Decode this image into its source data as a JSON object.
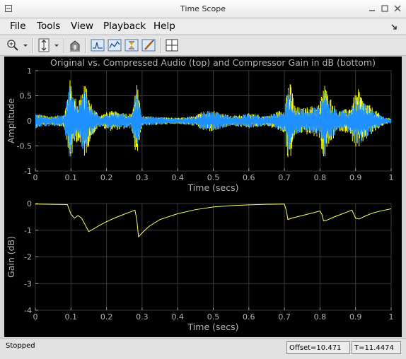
{
  "window": {
    "title": "Time Scope"
  },
  "menu": {
    "items": [
      "File",
      "Tools",
      "View",
      "Playback",
      "Help"
    ]
  },
  "toolbar": {
    "icons": [
      "zoom-in-icon",
      "dropdown-arrow-icon",
      "scale-axes-icon",
      "dropdown-arrow-icon",
      "restore-view-icon",
      "triggers-icon",
      "cursor-measurements-icon",
      "signal-statistics-icon",
      "peak-finder-icon",
      "style-icon",
      "layout-icon"
    ]
  },
  "figure": {
    "title": "Original vs. Compressed Audio (top) and Compressor Gain in dB (bottom)"
  },
  "chart_data": [
    {
      "type": "line",
      "title": "Original vs. Compressed Audio (top) and Compressor Gain in dB (bottom)",
      "xlabel": "Time (secs)",
      "ylabel": "Amplitude",
      "xlim": [
        0,
        1
      ],
      "ylim": [
        -1,
        1
      ],
      "xticks": [
        "0",
        "0.1",
        "0.2",
        "0.3",
        "0.4",
        "0.5",
        "0.6",
        "0.7",
        "0.8",
        "0.9",
        "1"
      ],
      "yticks": [
        "1",
        "0.5",
        "0",
        "-0.5",
        "-1"
      ],
      "grid": true,
      "series": [
        {
          "color": "#ffff00",
          "envelope": [
            [
              0.0,
              0.15
            ],
            [
              0.02,
              0.12
            ],
            [
              0.05,
              0.1
            ],
            [
              0.08,
              0.12
            ],
            [
              0.09,
              0.5
            ],
            [
              0.095,
              0.85
            ],
            [
              0.1,
              0.8
            ],
            [
              0.11,
              0.5
            ],
            [
              0.12,
              0.4
            ],
            [
              0.13,
              0.65
            ],
            [
              0.14,
              0.75
            ],
            [
              0.15,
              0.5
            ],
            [
              0.16,
              0.3
            ],
            [
              0.18,
              0.12
            ],
            [
              0.21,
              0.2
            ],
            [
              0.24,
              0.18
            ],
            [
              0.27,
              0.15
            ],
            [
              0.28,
              0.6
            ],
            [
              0.285,
              0.85
            ],
            [
              0.29,
              0.5
            ],
            [
              0.3,
              0.1
            ],
            [
              0.35,
              0.08
            ],
            [
              0.4,
              0.06
            ],
            [
              0.45,
              0.1
            ],
            [
              0.47,
              0.2
            ],
            [
              0.5,
              0.22
            ],
            [
              0.55,
              0.1
            ],
            [
              0.6,
              0.15
            ],
            [
              0.65,
              0.1
            ],
            [
              0.7,
              0.25
            ],
            [
              0.71,
              0.85
            ],
            [
              0.72,
              0.7
            ],
            [
              0.73,
              0.3
            ],
            [
              0.75,
              0.25
            ],
            [
              0.8,
              0.35
            ],
            [
              0.81,
              0.85
            ],
            [
              0.82,
              0.6
            ],
            [
              0.85,
              0.2
            ],
            [
              0.88,
              0.25
            ],
            [
              0.9,
              0.55
            ],
            [
              0.91,
              0.65
            ],
            [
              0.92,
              0.45
            ],
            [
              0.95,
              0.25
            ],
            [
              0.98,
              0.08
            ],
            [
              1.0,
              0.05
            ]
          ]
        },
        {
          "color": "#1e90ff",
          "envelope": [
            [
              0.0,
              0.15
            ],
            [
              0.02,
              0.12
            ],
            [
              0.05,
              0.1
            ],
            [
              0.08,
              0.12
            ],
            [
              0.09,
              0.5
            ],
            [
              0.095,
              0.75
            ],
            [
              0.1,
              0.7
            ],
            [
              0.11,
              0.45
            ],
            [
              0.12,
              0.35
            ],
            [
              0.13,
              0.55
            ],
            [
              0.14,
              0.6
            ],
            [
              0.15,
              0.4
            ],
            [
              0.16,
              0.25
            ],
            [
              0.18,
              0.12
            ],
            [
              0.21,
              0.18
            ],
            [
              0.24,
              0.16
            ],
            [
              0.27,
              0.14
            ],
            [
              0.28,
              0.5
            ],
            [
              0.285,
              0.65
            ],
            [
              0.29,
              0.4
            ],
            [
              0.3,
              0.1
            ],
            [
              0.35,
              0.08
            ],
            [
              0.4,
              0.06
            ],
            [
              0.45,
              0.1
            ],
            [
              0.47,
              0.2
            ],
            [
              0.5,
              0.2
            ],
            [
              0.55,
              0.1
            ],
            [
              0.6,
              0.14
            ],
            [
              0.65,
              0.1
            ],
            [
              0.7,
              0.22
            ],
            [
              0.71,
              0.7
            ],
            [
              0.72,
              0.55
            ],
            [
              0.73,
              0.28
            ],
            [
              0.75,
              0.22
            ],
            [
              0.8,
              0.3
            ],
            [
              0.81,
              0.7
            ],
            [
              0.82,
              0.5
            ],
            [
              0.85,
              0.2
            ],
            [
              0.88,
              0.22
            ],
            [
              0.9,
              0.45
            ],
            [
              0.91,
              0.5
            ],
            [
              0.92,
              0.4
            ],
            [
              0.95,
              0.2
            ],
            [
              0.98,
              0.08
            ],
            [
              1.0,
              0.05
            ]
          ]
        }
      ]
    },
    {
      "type": "line",
      "xlabel": "Time (secs)",
      "ylabel": "Gain (dB)",
      "xlim": [
        0,
        1
      ],
      "ylim": [
        -4,
        0
      ],
      "xticks": [
        "0",
        "0.1",
        "0.2",
        "0.3",
        "0.4",
        "0.5",
        "0.6",
        "0.7",
        "0.8",
        "0.9",
        "1"
      ],
      "yticks": [
        "0",
        "-1",
        "-2",
        "-3",
        "-4"
      ],
      "grid": true,
      "series": [
        {
          "color": "#ffff66",
          "points": [
            [
              0,
              -0.02
            ],
            [
              0.09,
              -0.04
            ],
            [
              0.1,
              -0.4
            ],
            [
              0.11,
              -0.55
            ],
            [
              0.12,
              -0.45
            ],
            [
              0.13,
              -0.55
            ],
            [
              0.14,
              -0.8
            ],
            [
              0.15,
              -1.05
            ],
            [
              0.16,
              -0.98
            ],
            [
              0.18,
              -0.82
            ],
            [
              0.2,
              -0.68
            ],
            [
              0.22,
              -0.56
            ],
            [
              0.24,
              -0.45
            ],
            [
              0.26,
              -0.35
            ],
            [
              0.28,
              -0.25
            ],
            [
              0.285,
              -0.6
            ],
            [
              0.29,
              -1.25
            ],
            [
              0.3,
              -1.1
            ],
            [
              0.32,
              -0.85
            ],
            [
              0.35,
              -0.6
            ],
            [
              0.4,
              -0.38
            ],
            [
              0.45,
              -0.23
            ],
            [
              0.5,
              -0.13
            ],
            [
              0.55,
              -0.08
            ],
            [
              0.6,
              -0.05
            ],
            [
              0.65,
              -0.03
            ],
            [
              0.7,
              -0.02
            ],
            [
              0.705,
              -0.25
            ],
            [
              0.71,
              -0.6
            ],
            [
              0.72,
              -0.55
            ],
            [
              0.75,
              -0.45
            ],
            [
              0.78,
              -0.35
            ],
            [
              0.8,
              -0.28
            ],
            [
              0.805,
              -0.4
            ],
            [
              0.81,
              -0.65
            ],
            [
              0.82,
              -0.62
            ],
            [
              0.84,
              -0.5
            ],
            [
              0.86,
              -0.4
            ],
            [
              0.88,
              -0.3
            ],
            [
              0.89,
              -0.25
            ],
            [
              0.9,
              -0.55
            ],
            [
              0.91,
              -0.58
            ],
            [
              0.93,
              -0.45
            ],
            [
              0.95,
              -0.35
            ],
            [
              0.97,
              -0.28
            ],
            [
              1.0,
              -0.2
            ]
          ]
        }
      ]
    }
  ],
  "status": {
    "state": "Stopped",
    "offset": "Offset=10.471",
    "time": "T=11.4474"
  }
}
